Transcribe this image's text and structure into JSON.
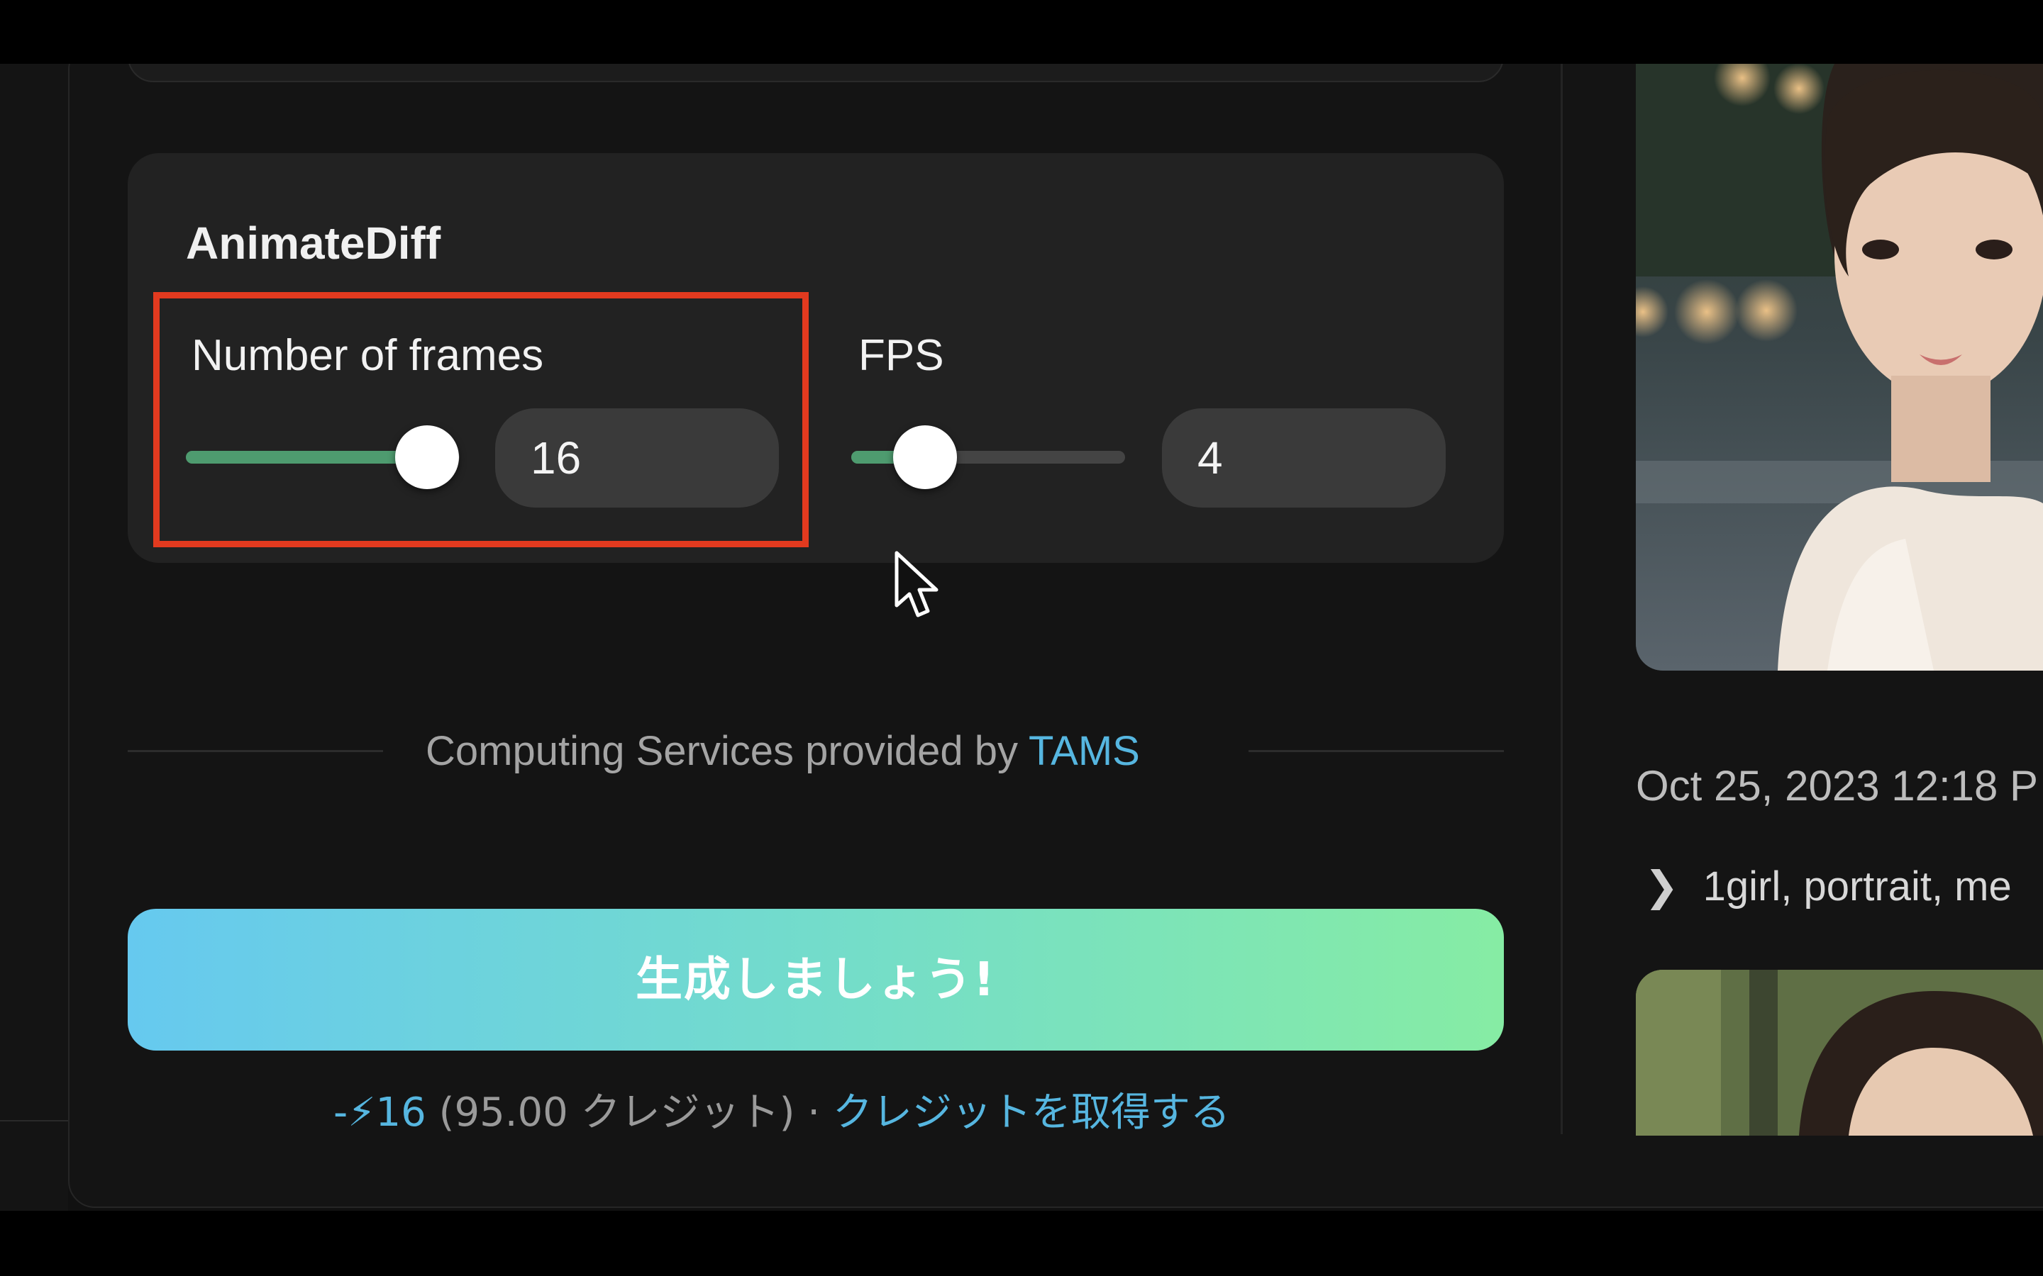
{
  "section": {
    "title": "AnimateDiff",
    "frames": {
      "label": "Number of frames",
      "value": "16",
      "slider_level": 0.88
    },
    "fps": {
      "label": "FPS",
      "value": "4",
      "slider_level": 0.27
    }
  },
  "footer": {
    "provided_by_text": "Computing Services provided by ",
    "provider_name": "TAMS",
    "generate_label": "生成しましょう!",
    "cost_prefix": "-⚡16",
    "cost_balance": " (95.00 クレジット) · ",
    "get_credits_label": "クレジットを取得する"
  },
  "history": {
    "timestamp": "Oct 25, 2023 12:18 P",
    "prompt_preview": "1girl, portrait, me"
  },
  "colors": {
    "accent_green": "#4e9b6f",
    "link_blue": "#56b6e0",
    "highlight_red": "#e23a1f"
  }
}
